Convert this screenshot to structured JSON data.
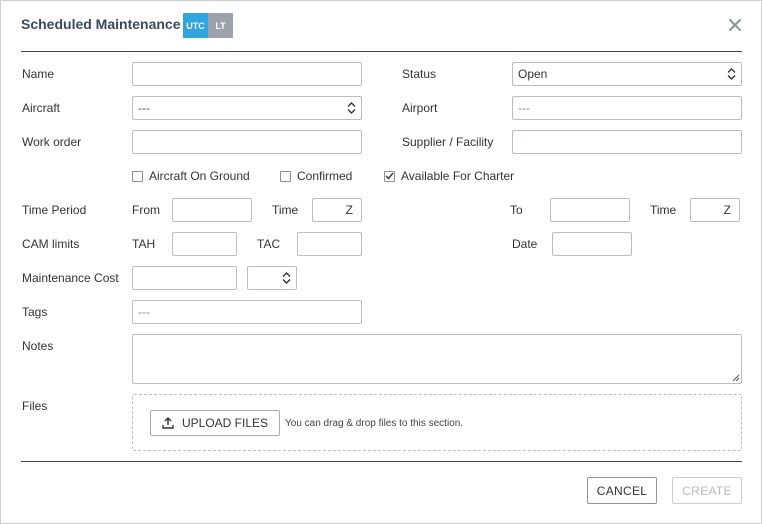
{
  "header": {
    "title": "Scheduled Maintenance",
    "tz_utc": "UTC",
    "tz_lt": "LT"
  },
  "form": {
    "name_label": "Name",
    "status_label": "Status",
    "status_value": "Open",
    "aircraft_label": "Aircraft",
    "aircraft_value": "---",
    "airport_label": "Airport",
    "airport_placeholder": "---",
    "work_order_label": "Work order",
    "supplier_label": "Supplier / Facility",
    "checkboxes": [
      {
        "label": "Aircraft On Ground",
        "checked": false
      },
      {
        "label": "Confirmed",
        "checked": false
      },
      {
        "label": "Available For Charter",
        "checked": true
      }
    ],
    "time_period_label": "Time Period",
    "from_label": "From",
    "time_label": "Time",
    "time_suffix": "Z",
    "to_label": "To",
    "time2_label": "Time",
    "time2_suffix": "Z",
    "cam_label": "CAM limits",
    "tah_label": "TAH",
    "tac_label": "TAC",
    "date_label": "Date",
    "cost_label": "Maintenance Cost",
    "tags_label": "Tags",
    "tags_placeholder": "---",
    "notes_label": "Notes",
    "files_label": "Files",
    "upload_label": "UPLOAD FILES",
    "upload_hint": "You can drag & drop files to this section."
  },
  "footer": {
    "cancel_label": "CANCEL",
    "create_label": "CREATE"
  },
  "colors": {
    "utc": "#2fa6e0",
    "lt": "#9aa3ad",
    "title": "#3a4a5e"
  },
  "icons": {
    "close": "close-icon",
    "upload": "upload-icon",
    "select": "chevron-up-down-icon",
    "check": "check-icon"
  }
}
